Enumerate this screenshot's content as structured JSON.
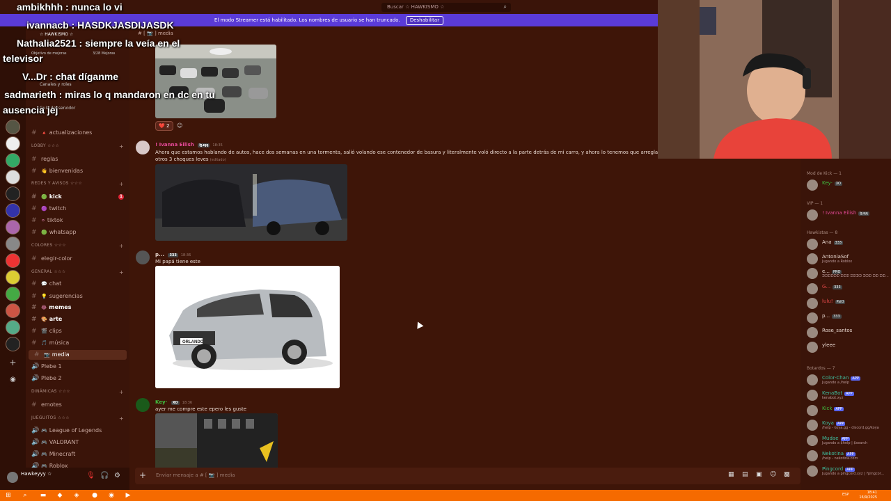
{
  "search": {
    "placeholder": "Buscar ☆ HAWKISMO ☆"
  },
  "streamer_banner": {
    "text": "El modo Streamer está habilitado. Los nombres de usuario se han truncado.",
    "button": "Deshabilitar"
  },
  "server": {
    "name": "☆ HAWKISMO ☆",
    "goal": "Objetivo de mejoras",
    "boosts": "3/28 Mejoras"
  },
  "sidebar_top": {
    "channels_roles": "Canales y roles",
    "guide": "Guía del servidor"
  },
  "channels": [
    {
      "kind": "text",
      "emoji": "🔺",
      "label": "actualizaciones"
    },
    {
      "kind": "category",
      "label": "LOBBY ☆☆☆"
    },
    {
      "kind": "text",
      "emoji": "",
      "label": "reglas"
    },
    {
      "kind": "text",
      "emoji": "👋",
      "label": "bienvenidas"
    },
    {
      "kind": "category",
      "label": "REDES Y AVISOS ☆☆☆"
    },
    {
      "kind": "text",
      "emoji": "🟢",
      "label": "kick",
      "bold": true,
      "badge": "1"
    },
    {
      "kind": "text",
      "emoji": "🟣",
      "label": "twitch"
    },
    {
      "kind": "text",
      "emoji": "⚪",
      "label": "tiktok"
    },
    {
      "kind": "text",
      "emoji": "🟢",
      "label": "whatsapp"
    },
    {
      "kind": "category",
      "label": "COLORES ☆☆☆"
    },
    {
      "kind": "text",
      "emoji": "",
      "label": "elegir-color"
    },
    {
      "kind": "category",
      "label": "GENERAL ☆☆☆"
    },
    {
      "kind": "text",
      "emoji": "💬",
      "label": "chat"
    },
    {
      "kind": "text",
      "emoji": "💡",
      "label": "sugerencias"
    },
    {
      "kind": "text",
      "emoji": "😂",
      "label": "memes",
      "bold": true
    },
    {
      "kind": "text",
      "emoji": "🎨",
      "label": "arte",
      "bold": true
    },
    {
      "kind": "text",
      "emoji": "🎬",
      "label": "clips"
    },
    {
      "kind": "text",
      "emoji": "🎵",
      "label": "música"
    },
    {
      "kind": "text",
      "emoji": "📷",
      "label": "media",
      "active": true
    },
    {
      "kind": "voice",
      "emoji": "",
      "label": "Plebe 1"
    },
    {
      "kind": "voice",
      "emoji": "",
      "label": "Plebe 2"
    },
    {
      "kind": "category",
      "label": "DINÁMICAS ☆☆☆"
    },
    {
      "kind": "text",
      "emoji": "",
      "label": "emotes"
    },
    {
      "kind": "category",
      "label": "JUEGUITOS ☆☆☆"
    },
    {
      "kind": "voice",
      "emoji": "🎮",
      "label": "League of Legends"
    },
    {
      "kind": "voice",
      "emoji": "🎮",
      "label": "VALORANT"
    },
    {
      "kind": "voice",
      "emoji": "🎮",
      "label": "Minecraft"
    },
    {
      "kind": "voice",
      "emoji": "🎮",
      "label": "Roblox"
    }
  ],
  "user": {
    "name": "Hawkeyyy ☆"
  },
  "chat_header": {
    "channel": "[ 📷 ] media"
  },
  "messages": [
    {
      "author": "",
      "reaction": "❤️ 2"
    },
    {
      "author": "! Ivanna Eilish",
      "author_color": "#e84a9a",
      "tag": "ɮɹӄӄ",
      "time": "18:35",
      "text": "Ahora que estamos hablando de autos, hace dos semanas en una tormenta, salió volando ese contenedor de basura y literalmente voló directo a la parte detrás de mi carro, y ahora lo tenemos que arreglar, no pode",
      "text2": "otros 3 choques leves",
      "edited": "(editado)"
    },
    {
      "author": "p...",
      "author_color": "#e8d8d0",
      "tag": "333",
      "time": "18:36",
      "text": "Mi papá tiene este",
      "car_label": "ORLANDO"
    },
    {
      "author": "Key·",
      "author_color": "#3fbf3f",
      "tag": "XO",
      "time": "18:36",
      "text": "ayer me compre este epero les guste"
    }
  ],
  "composer": {
    "placeholder": "Enviar mensaje a # [ 📷 ] media"
  },
  "members": {
    "sections": [
      {
        "title": "Mod de Kick — 1",
        "items": [
          {
            "name": "Key·",
            "sub": "",
            "color": "#3fbf3f",
            "tag": "XO"
          }
        ]
      },
      {
        "title": "VIP — 1",
        "items": [
          {
            "name": "! Ivanna Eilish",
            "sub": "",
            "color": "#e84a9a",
            "tag": "ɮɹӄӄ"
          }
        ]
      },
      {
        "title": "Hawkistas — 8",
        "items": [
          {
            "name": "Ana",
            "sub": "",
            "color": "#e8d8d0",
            "tag": "333"
          },
          {
            "name": "AntoniaSof",
            "sub": "Jugando a Roblox",
            "color": "#e8d8d0",
            "tag": ""
          },
          {
            "name": "e...",
            "sub": "ᗪᗪᗪᗪᗪᗪ ᗪᗪᗪ ᗪᗪᗪᗪ ᗪᗪᗪ ᗪᗪ ᗪᗪ...",
            "color": "#e8d8d0",
            "tag": "PRO"
          },
          {
            "name": "G...",
            "sub": "",
            "color": "#e84a4a",
            "tag": "333"
          },
          {
            "name": "lulu!",
            "sub": "",
            "color": "#e84a4a",
            "tag": "PsiO"
          },
          {
            "name": "p...",
            "sub": "",
            "color": "#e8d8d0",
            "tag": "333"
          },
          {
            "name": "Rose_santos",
            "sub": "",
            "color": "#e8d8d0",
            "tag": ""
          },
          {
            "name": "yleee",
            "sub": "",
            "color": "#e8d8d0",
            "tag": ""
          }
        ]
      },
      {
        "title": "Botardos — 7",
        "items": [
          {
            "name": "Color-Chan",
            "sub": "Jugando a /help",
            "color": "#3fbf9f",
            "tag": "APP"
          },
          {
            "name": "KenaBot",
            "sub": "kenabot.xyz",
            "color": "#3fbf9f",
            "tag": "APP"
          },
          {
            "name": "Kick",
            "sub": "",
            "color": "#3fbf3f",
            "tag": "APP"
          },
          {
            "name": "Koya",
            "sub": "/help - koya.gg - discord.gg/koya",
            "color": "#3fbf9f",
            "tag": "APP"
          },
          {
            "name": "Mudae",
            "sub": "Jugando a $help | $search",
            "color": "#3fbf9f",
            "tag": "APP"
          },
          {
            "name": "Nekotina",
            "sub": "/help - nekotina.com",
            "color": "#3fbf9f",
            "tag": "APP"
          },
          {
            "name": "Pingcord",
            "sub": "Jugando a pingcord.xyz | ?pingcor...",
            "color": "#3fbf9f",
            "tag": "APP"
          }
        ]
      }
    ]
  },
  "overlay_chat": [
    {
      "user": "ambikhhh",
      "text": "nunca lo vi"
    },
    {
      "user": "ivannacb",
      "text": "HASDKJASDIJASDK"
    },
    {
      "user": "Nathalia2521",
      "text": "siempre la veía en el"
    },
    {
      "user": "",
      "text": "televisor"
    },
    {
      "user": "V...Dr",
      "text": "chat díganme"
    },
    {
      "user": "sadmarieth",
      "text": "miras lo q mandaron en dc en tu"
    },
    {
      "user": "",
      "text": "ausencia jej"
    }
  ],
  "taskbar": {
    "time": "18:41",
    "date": "16/9/2025",
    "lang": "ESP"
  },
  "colors": {
    "accent": "#5865f2",
    "bg": "#3e1508",
    "taskbar": "#f56a00",
    "banner": "#5a3bd8"
  }
}
